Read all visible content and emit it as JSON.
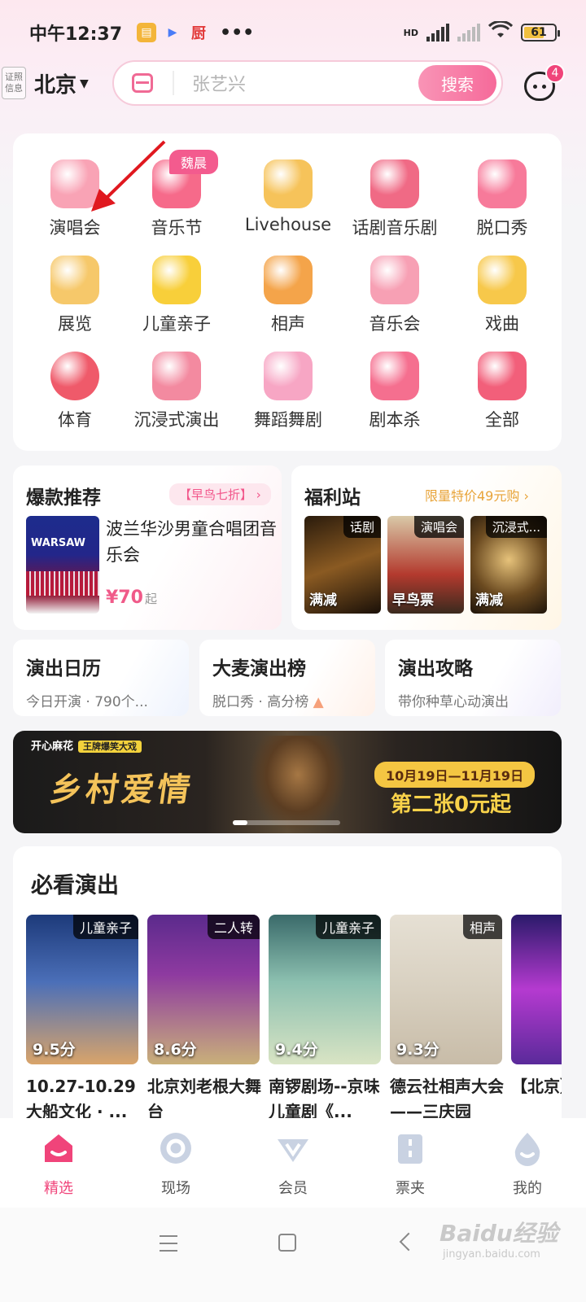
{
  "status_bar": {
    "time": "中午12:37",
    "battery": "61",
    "network": "HD"
  },
  "header": {
    "cert_line1": "证照",
    "cert_line2": "信息",
    "city": "北京",
    "search_placeholder": "张艺兴",
    "search_button": "搜索",
    "message_badge": "4"
  },
  "categories": [
    {
      "label": "演唱会",
      "icon": "microphone-icon"
    },
    {
      "label": "音乐节",
      "icon": "music-festival-icon"
    },
    {
      "label": "Livehouse",
      "icon": "guitar-icon"
    },
    {
      "label": "话剧音乐剧",
      "icon": "theater-curtain-icon"
    },
    {
      "label": "脱口秀",
      "icon": "lips-icon"
    },
    {
      "label": "展览",
      "icon": "picture-frame-icon"
    },
    {
      "label": "儿童亲子",
      "icon": "duck-icon"
    },
    {
      "label": "相声",
      "icon": "fan-clapper-icon"
    },
    {
      "label": "音乐会",
      "icon": "piano-icon"
    },
    {
      "label": "戏曲",
      "icon": "folding-fan-icon"
    },
    {
      "label": "体育",
      "icon": "soccer-ball-icon"
    },
    {
      "label": "沉浸式演出",
      "icon": "vr-headset-icon"
    },
    {
      "label": "舞蹈舞剧",
      "icon": "dancer-icon"
    },
    {
      "label": "剧本杀",
      "icon": "detective-hat-icon"
    },
    {
      "label": "全部",
      "icon": "grid-all-icon"
    }
  ],
  "category_tag": "魏晨",
  "hot": {
    "title": "爆款推荐",
    "tag": "【早鸟七折】 ›",
    "poster_text": "WARSAW",
    "name": "波兰华沙男童合唱团音乐会",
    "price": "¥70",
    "price_suffix": "起"
  },
  "fuli": {
    "title": "福利站",
    "tag": "限量特价49元购 ›",
    "items": [
      {
        "category": "话剧",
        "badge": "满减"
      },
      {
        "category": "演唱会",
        "badge": "早鸟票"
      },
      {
        "category": "沉浸式...",
        "badge": "满减"
      }
    ]
  },
  "entries": [
    {
      "title": "演出日历",
      "sub": "今日开演 · 790个..."
    },
    {
      "title": "大麦演出榜",
      "sub": "脱口秀 · 高分榜"
    },
    {
      "title": "演出攻略",
      "sub": "带你种草心动演出"
    }
  ],
  "banner": {
    "brand": "开心麻花",
    "brand_tag": "王牌爆笑大戏",
    "title": "乡村爱情",
    "date": "10月19日—11月19日",
    "deal": "第二张0元起"
  },
  "must_see": {
    "title": "必看演出",
    "shows": [
      {
        "category": "儿童亲子",
        "score": "9.5分",
        "name": "10.27-10.29 大船文化 · ..."
      },
      {
        "category": "二人转",
        "score": "8.6分",
        "name": "北京刘老根大舞台"
      },
      {
        "category": "儿童亲子",
        "score": "9.4分",
        "name": "南锣剧场--京味儿童剧《..."
      },
      {
        "category": "相声",
        "score": "9.3分",
        "name": "德云社相声大会——三庆园"
      },
      {
        "category": "",
        "score": "",
        "name": "【北京】全新巨"
      }
    ]
  },
  "tabs": [
    {
      "label": "精选",
      "icon": "home-icon"
    },
    {
      "label": "现场",
      "icon": "live-icon"
    },
    {
      "label": "会员",
      "icon": "vip-icon"
    },
    {
      "label": "票夹",
      "icon": "ticket-icon"
    },
    {
      "label": "我的",
      "icon": "profile-icon"
    }
  ],
  "watermark": {
    "brand": "Baidu经验",
    "sub": "jingyan.baidu.com"
  },
  "colors": {
    "accent": "#f0447a",
    "gold": "#f4c35a"
  }
}
